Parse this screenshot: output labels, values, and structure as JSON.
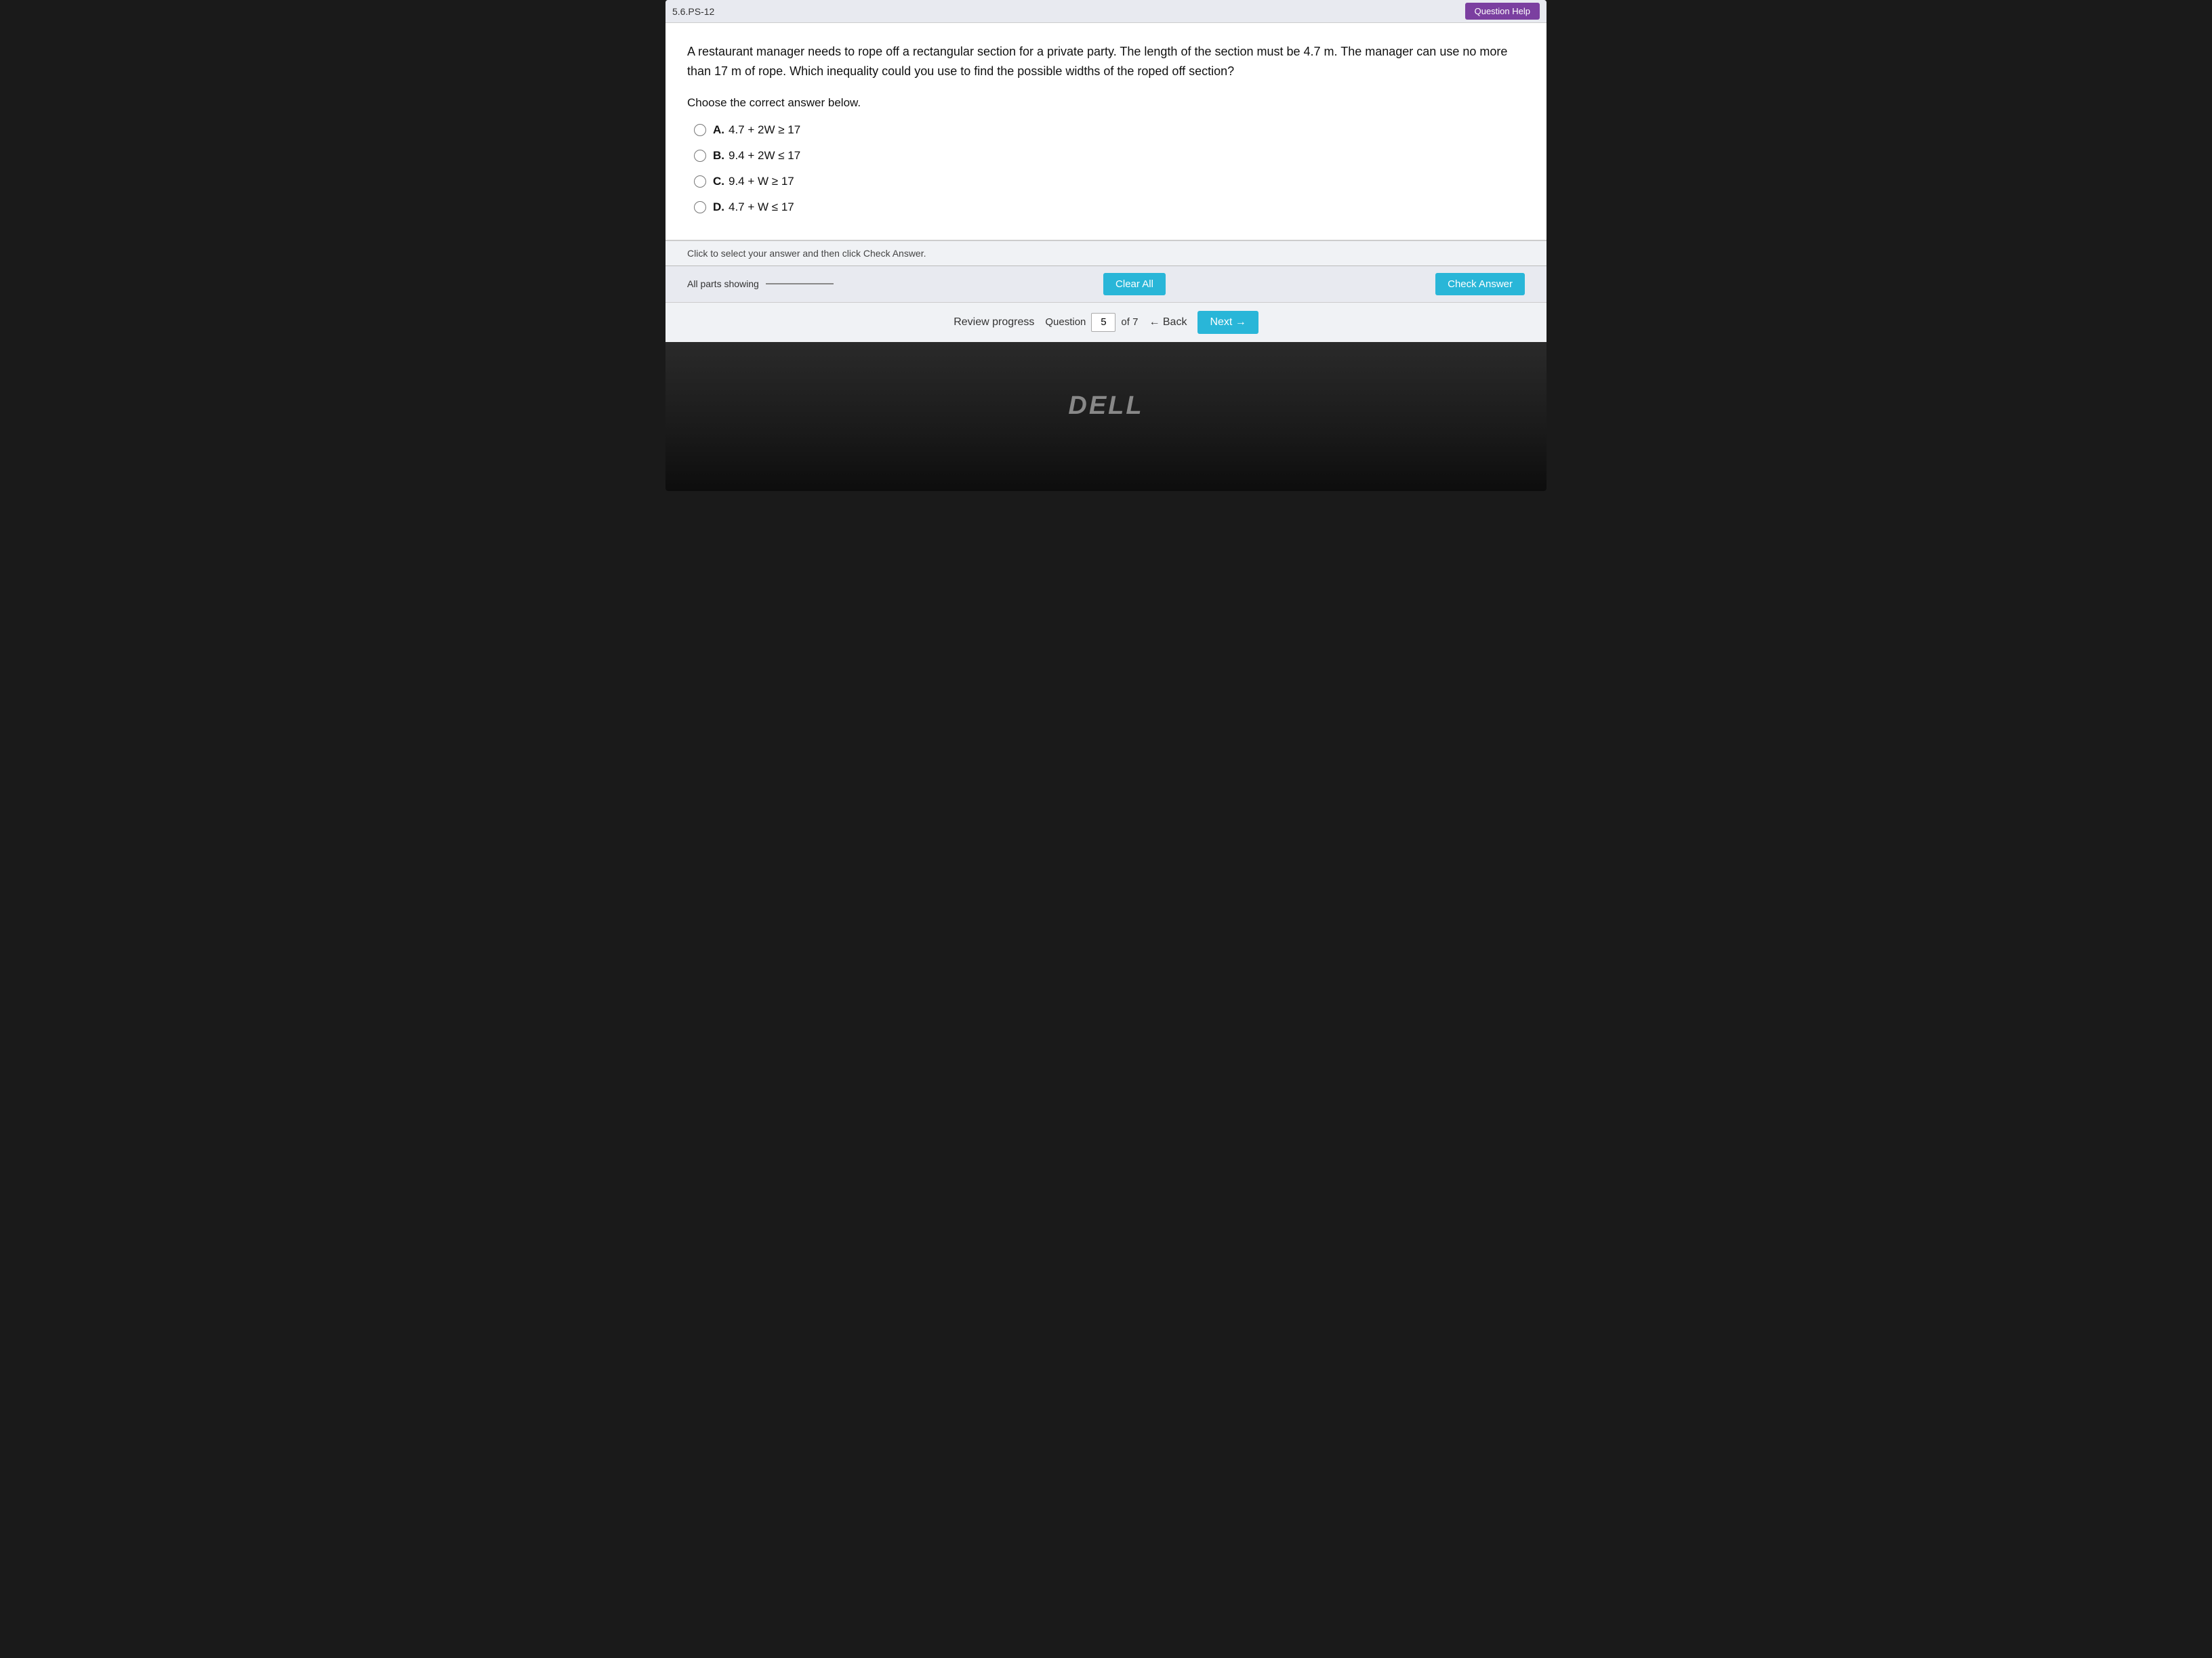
{
  "header": {
    "label": "5.6.PS-12",
    "question_help_label": "Question Help"
  },
  "question": {
    "text": "A restaurant manager needs to rope off a rectangular section for a private party. The length of the section must be 4.7 m. The manager can use no more than 17 m of rope. Which inequality could you use to find the possible widths of the roped off section?",
    "choose_label": "Choose the correct answer below.",
    "choices": [
      {
        "id": "A",
        "text": "4.7 + 2W ≥ 17"
      },
      {
        "id": "B",
        "text": "9.4 + 2W ≤ 17"
      },
      {
        "id": "C",
        "text": "9.4 + W ≥ 17"
      },
      {
        "id": "D",
        "text": "4.7 + W ≤ 17"
      }
    ]
  },
  "toolbar": {
    "instruction": "Click to select your answer and then click Check Answer.",
    "parts_showing_label": "All parts showing",
    "clear_all_label": "Clear All",
    "check_answer_label": "Check Answer"
  },
  "navigation": {
    "review_progress_label": "Review progress",
    "question_label": "Question",
    "question_number": "5",
    "of_label": "of 7",
    "back_label": "← Back",
    "next_label": "Next →"
  },
  "laptop": {
    "brand": "DELL"
  }
}
